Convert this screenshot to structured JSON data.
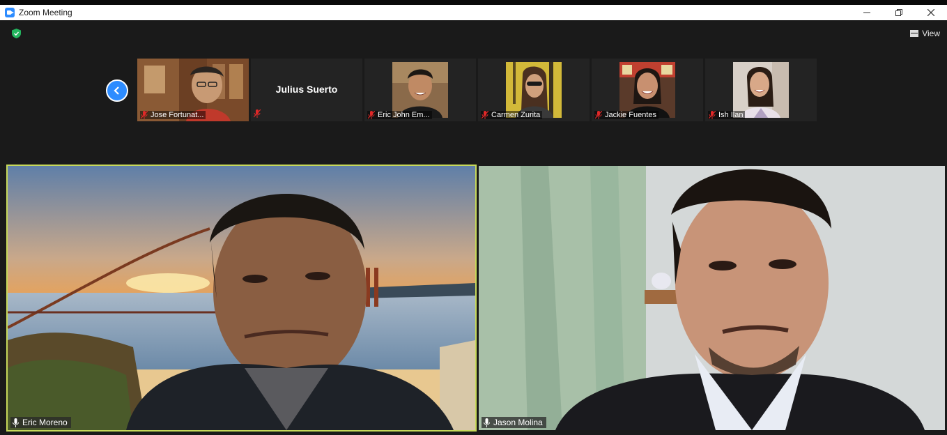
{
  "window": {
    "title": "Zoom Meeting",
    "minimize_icon": "minimize-icon",
    "restore_icon": "restore-icon",
    "close_icon": "close-icon"
  },
  "toolbar": {
    "security_icon": "shield-icon",
    "view_label": "View"
  },
  "gallery_strip": {
    "prev_icon": "chevron-left-icon",
    "participants": [
      {
        "name": "Jose Fortunat...",
        "muted": true,
        "video": true
      },
      {
        "name": "Julius Suerto",
        "muted": true,
        "video": false
      },
      {
        "name": "Eric John Em...",
        "muted": true,
        "video": true
      },
      {
        "name": "Carmen Zurita",
        "muted": true,
        "video": true
      },
      {
        "name": "Jackie Fuentes",
        "muted": true,
        "video": true
      },
      {
        "name": "Ish Ilan",
        "muted": true,
        "video": true
      }
    ]
  },
  "main_videos": [
    {
      "name": "Eric Moreno",
      "active_speaker": true,
      "muted": false
    },
    {
      "name": "Jason Molina",
      "active_speaker": false,
      "muted": false
    }
  ],
  "colors": {
    "active_speaker_border": "#c7d95a",
    "accent": "#2d8cff",
    "muted_icon": "#e02828",
    "security_green": "#23b55e"
  }
}
